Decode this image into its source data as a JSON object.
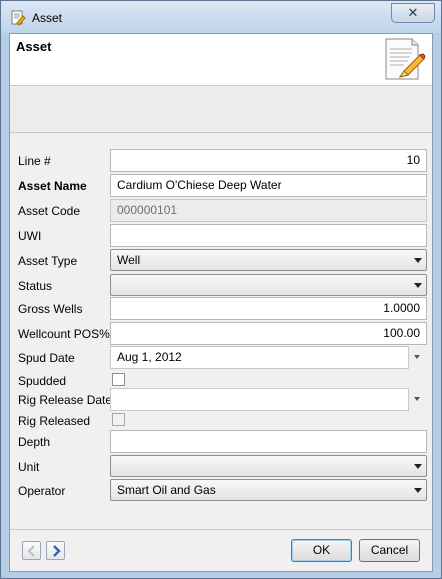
{
  "window": {
    "title": "Asset",
    "close_glyph": "✕"
  },
  "header": {
    "title": "Asset",
    "icon": "document-edit-icon"
  },
  "form": {
    "line": {
      "label": "Line #",
      "value": "10"
    },
    "asset_name": {
      "label": "Asset Name",
      "value": "Cardium O'Chiese Deep Water"
    },
    "asset_code": {
      "label": "Asset Code",
      "value": "000000101"
    },
    "uwi": {
      "label": "UWI",
      "value": ""
    },
    "asset_type": {
      "label": "Asset Type",
      "value": "Well"
    },
    "status": {
      "label": "Status",
      "value": ""
    },
    "gross_wells": {
      "label": "Gross Wells",
      "value": "1.0000"
    },
    "wellcount_pos": {
      "label": "Wellcount POS%",
      "value": "100.00"
    },
    "spud_date": {
      "label": "Spud Date",
      "value": "Aug 1, 2012"
    },
    "spudded": {
      "label": "Spudded",
      "checked": false
    },
    "rig_release_date": {
      "label": "Rig Release Date",
      "value": ""
    },
    "rig_released": {
      "label": "Rig Released",
      "checked": false
    },
    "depth": {
      "label": "Depth",
      "value": ""
    },
    "unit": {
      "label": "Unit",
      "value": ""
    },
    "operator": {
      "label": "Operator",
      "value": "Smart Oil and Gas"
    }
  },
  "footer": {
    "ok_label": "OK",
    "cancel_label": "Cancel"
  },
  "colors": {
    "nav_arrow": "#2f63b8",
    "nav_arrow_disabled": "#b9c3d0"
  }
}
